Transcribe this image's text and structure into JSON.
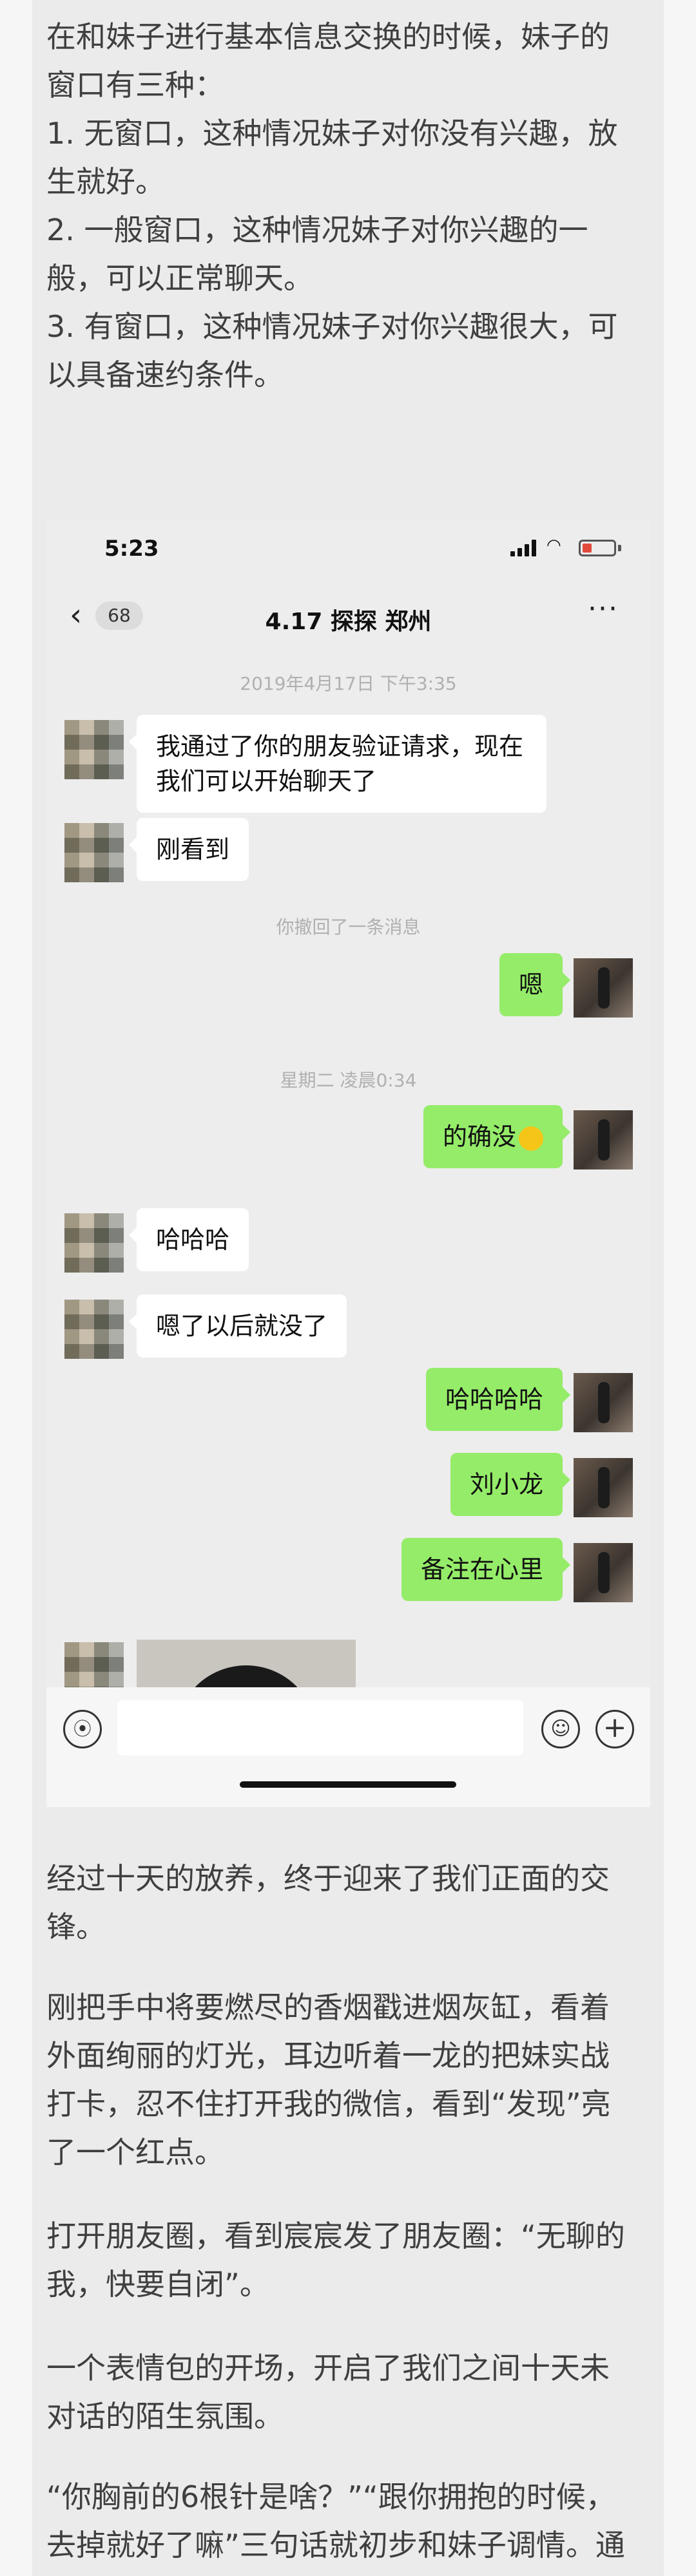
{
  "intro_lines": [
    "在和妹子进行基本信息交换的时候，妹子的",
    "窗口有三种：",
    "1. 无窗口，这种情况妹子对你没有兴趣，放",
    "生就好。",
    "2. 一般窗口，这种情况妹子对你兴趣的一",
    "般，可以正常聊天。",
    "3. 有窗口，这种情况妹子对你兴趣很大，可",
    "以具备速约条件。"
  ],
  "status_bar": {
    "time": "5:23"
  },
  "chat": {
    "unread_count": "68",
    "title": "4.17 探探 郑州",
    "timestamp_1": "2019年4月17日 下午3:35",
    "msg_1_lines": [
      "我通过了你的朋友验证请求，现在",
      "我们可以开始聊天了"
    ],
    "msg_2": "刚看到",
    "recall_notice": "你撤回了一条消息",
    "msg_3": "嗯",
    "timestamp_2": "星期二 凌晨0:34",
    "msg_4": "的确没",
    "msg_5": "哈哈哈",
    "msg_6": "嗯了以后就没了",
    "msg_7": "哈哈哈哈",
    "msg_8": "刘小龙",
    "msg_9": "备注在心里"
  },
  "paragraphs": [
    [
      "经过十天的放养，终于迎来了我们正面的交",
      "锋。"
    ],
    [
      "刚把手中将要燃尽的香烟戳进烟灰缸，看着",
      "外面绚丽的灯光，耳边听着一龙的把妹实战",
      "打卡，忍不住打开我的微信，看到“发现”亮",
      "了一个红点。"
    ],
    [
      "打开朋友圈，看到宸宸发了朋友圈：“无聊的",
      "我，快要自闭”。"
    ],
    [
      "一个表情包的开场，开启了我们之间十天未",
      "对话的陌生氛围。"
    ],
    [
      "“你胸前的6根针是啥？”“跟你拥抱的时候，",
      "去掉就好了嘛”三句话就初步和妹子调情。通"
    ]
  ],
  "colors": {
    "outgoing_bubble": "#95ec69",
    "incoming_bubble": "#ffffff",
    "chat_bg": "#ededed"
  }
}
